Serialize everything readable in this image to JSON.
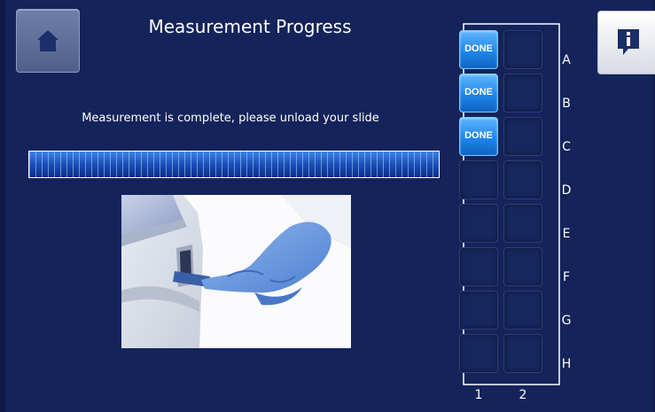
{
  "header": {
    "title": "Measurement Progress",
    "home_icon": "home-icon",
    "info_icon": "info-icon"
  },
  "status": {
    "message": "Measurement is complete, please unload your slide",
    "progress": 1.0
  },
  "illustration": {
    "subject": "gloved hand unloading slide from instrument"
  },
  "tray": {
    "columns": [
      "1",
      "2"
    ],
    "rows": [
      "A",
      "B",
      "C",
      "D",
      "E",
      "F",
      "G",
      "H"
    ],
    "done_label": "DONE",
    "wells": [
      {
        "row": "A",
        "col": "1",
        "done": true
      },
      {
        "row": "A",
        "col": "2",
        "done": false
      },
      {
        "row": "B",
        "col": "1",
        "done": true
      },
      {
        "row": "B",
        "col": "2",
        "done": false
      },
      {
        "row": "C",
        "col": "1",
        "done": true
      },
      {
        "row": "C",
        "col": "2",
        "done": false
      },
      {
        "row": "D",
        "col": "1",
        "done": false
      },
      {
        "row": "D",
        "col": "2",
        "done": false
      },
      {
        "row": "E",
        "col": "1",
        "done": false
      },
      {
        "row": "E",
        "col": "2",
        "done": false
      },
      {
        "row": "F",
        "col": "1",
        "done": false
      },
      {
        "row": "F",
        "col": "2",
        "done": false
      },
      {
        "row": "G",
        "col": "1",
        "done": false
      },
      {
        "row": "G",
        "col": "2",
        "done": false
      },
      {
        "row": "H",
        "col": "1",
        "done": false
      },
      {
        "row": "H",
        "col": "2",
        "done": false
      }
    ],
    "current_row": "D"
  },
  "colors": {
    "background": "#14235a",
    "done_well": "#1f86e8",
    "empty_well": "#16275e"
  }
}
